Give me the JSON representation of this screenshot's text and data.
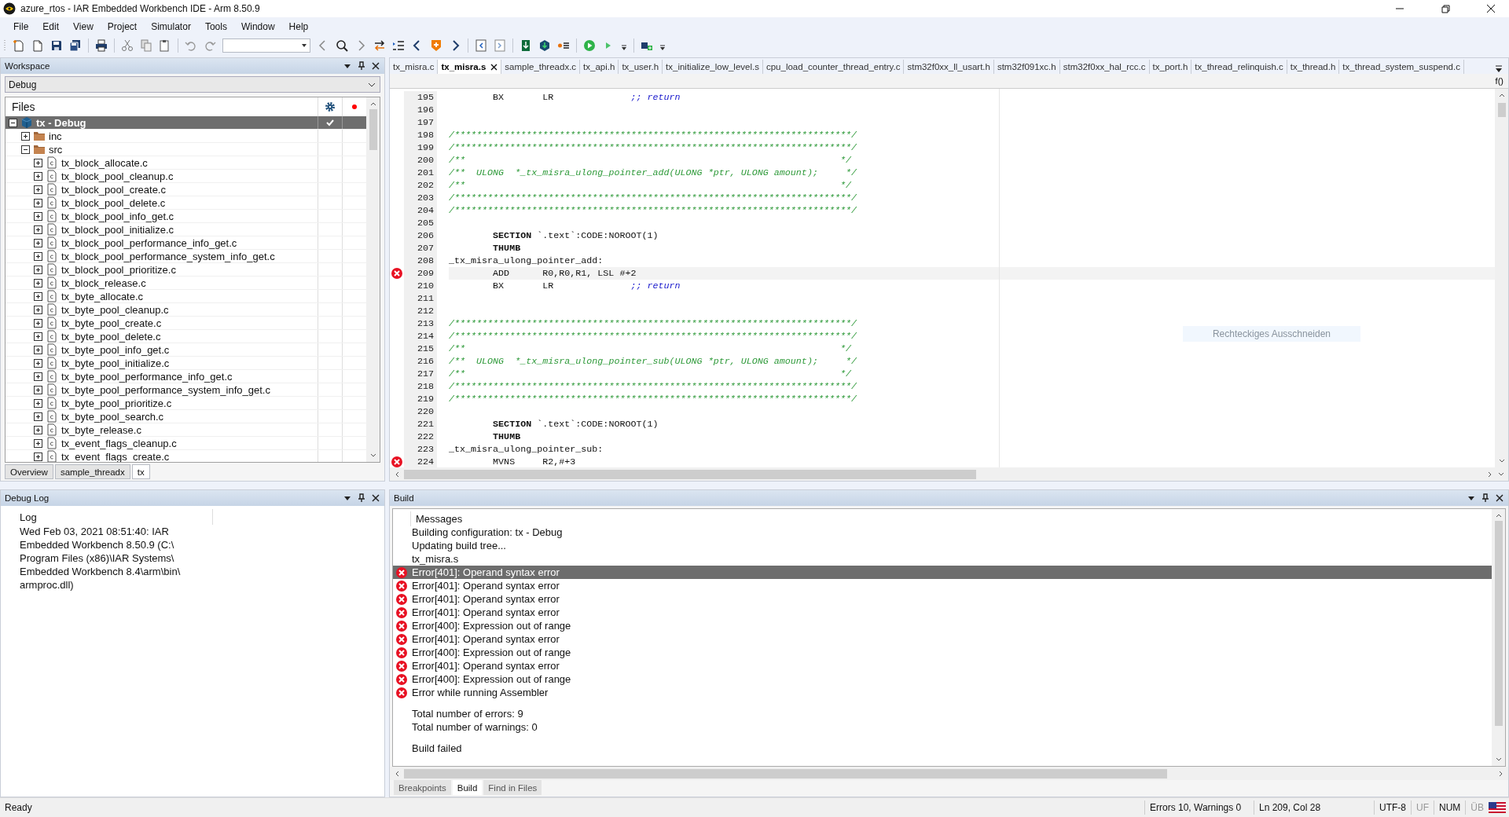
{
  "window": {
    "title": "azure_rtos - IAR Embedded Workbench IDE - Arm 8.50.9"
  },
  "menu": [
    "File",
    "Edit",
    "View",
    "Project",
    "Simulator",
    "Tools",
    "Window",
    "Help"
  ],
  "workspace": {
    "title": "Workspace",
    "configuration": "Debug",
    "files_header": "Files",
    "tree": {
      "label": "tx - Debug",
      "kind": "project",
      "expanded": true,
      "selected": true,
      "checked": true,
      "children": [
        {
          "label": "inc",
          "kind": "folder",
          "expanded": false,
          "selected": false
        },
        {
          "label": "src",
          "kind": "folder",
          "expanded": true,
          "selected": false,
          "children": [
            {
              "label": "tx_block_allocate.c",
              "kind": "file",
              "expanded": false,
              "selected": false
            },
            {
              "label": "tx_block_pool_cleanup.c",
              "kind": "file",
              "expanded": false,
              "selected": false
            },
            {
              "label": "tx_block_pool_create.c",
              "kind": "file",
              "expanded": false,
              "selected": false
            },
            {
              "label": "tx_block_pool_delete.c",
              "kind": "file",
              "expanded": false,
              "selected": false
            },
            {
              "label": "tx_block_pool_info_get.c",
              "kind": "file",
              "expanded": false,
              "selected": false
            },
            {
              "label": "tx_block_pool_initialize.c",
              "kind": "file",
              "expanded": false,
              "selected": false
            },
            {
              "label": "tx_block_pool_performance_info_get.c",
              "kind": "file",
              "expanded": false,
              "selected": false
            },
            {
              "label": "tx_block_pool_performance_system_info_get.c",
              "kind": "file",
              "expanded": false,
              "selected": false
            },
            {
              "label": "tx_block_pool_prioritize.c",
              "kind": "file",
              "expanded": false,
              "selected": false
            },
            {
              "label": "tx_block_release.c",
              "kind": "file",
              "expanded": false,
              "selected": false
            },
            {
              "label": "tx_byte_allocate.c",
              "kind": "file",
              "expanded": false,
              "selected": false
            },
            {
              "label": "tx_byte_pool_cleanup.c",
              "kind": "file",
              "expanded": false,
              "selected": false
            },
            {
              "label": "tx_byte_pool_create.c",
              "kind": "file",
              "expanded": false,
              "selected": false
            },
            {
              "label": "tx_byte_pool_delete.c",
              "kind": "file",
              "expanded": false,
              "selected": false
            },
            {
              "label": "tx_byte_pool_info_get.c",
              "kind": "file",
              "expanded": false,
              "selected": false
            },
            {
              "label": "tx_byte_pool_initialize.c",
              "kind": "file",
              "expanded": false,
              "selected": false
            },
            {
              "label": "tx_byte_pool_performance_info_get.c",
              "kind": "file",
              "expanded": false,
              "selected": false
            },
            {
              "label": "tx_byte_pool_performance_system_info_get.c",
              "kind": "file",
              "expanded": false,
              "selected": false
            },
            {
              "label": "tx_byte_pool_prioritize.c",
              "kind": "file",
              "expanded": false,
              "selected": false
            },
            {
              "label": "tx_byte_pool_search.c",
              "kind": "file",
              "expanded": false,
              "selected": false
            },
            {
              "label": "tx_byte_release.c",
              "kind": "file",
              "expanded": false,
              "selected": false
            },
            {
              "label": "tx_event_flags_cleanup.c",
              "kind": "file",
              "expanded": false,
              "selected": false
            },
            {
              "label": "tx_event_flags_create.c",
              "kind": "file",
              "expanded": false,
              "selected": false
            }
          ]
        }
      ]
    },
    "tabs": [
      {
        "label": "Overview",
        "selected": false
      },
      {
        "label": "sample_threadx",
        "selected": false
      },
      {
        "label": "tx",
        "selected": true
      }
    ]
  },
  "editor": {
    "tabs": [
      {
        "label": "tx_misra.c",
        "selected": false
      },
      {
        "label": "tx_misra.s",
        "selected": true
      },
      {
        "label": "sample_threadx.c",
        "selected": false
      },
      {
        "label": "tx_api.h",
        "selected": false
      },
      {
        "label": "tx_user.h",
        "selected": false
      },
      {
        "label": "tx_initialize_low_level.s",
        "selected": false
      },
      {
        "label": "cpu_load_counter_thread_entry.c",
        "selected": false
      },
      {
        "label": "stm32f0xx_ll_usart.h",
        "selected": false
      },
      {
        "label": "stm32f091xc.h",
        "selected": false
      },
      {
        "label": "stm32f0xx_hal_rcc.c",
        "selected": false
      },
      {
        "label": "tx_port.h",
        "selected": false
      },
      {
        "label": "tx_thread_relinquish.c",
        "selected": false
      },
      {
        "label": "tx_thread.h",
        "selected": false
      },
      {
        "label": "tx_thread_system_suspend.c",
        "selected": false
      }
    ],
    "function_button": "f()",
    "tooltip": "Rechteckiges Ausschneiden",
    "lines": [
      {
        "number": "195",
        "kind": "instruction",
        "error": false,
        "current": false,
        "op": "BX",
        "args": "LR",
        "remark": ";; return"
      },
      {
        "number": "196",
        "kind": "blank",
        "error": false,
        "current": false
      },
      {
        "number": "197",
        "kind": "blank",
        "error": false,
        "current": false
      },
      {
        "number": "198",
        "kind": "comment",
        "error": false,
        "current": false,
        "text": "/************************************************************************/"
      },
      {
        "number": "199",
        "kind": "comment",
        "error": false,
        "current": false,
        "text": "/************************************************************************/"
      },
      {
        "number": "200",
        "kind": "comment",
        "error": false,
        "current": false,
        "text": "/**                                                                    */"
      },
      {
        "number": "201",
        "kind": "comment",
        "error": false,
        "current": false,
        "text": "/**  ULONG  *_tx_misra_ulong_pointer_add(ULONG *ptr, ULONG amount);     */"
      },
      {
        "number": "202",
        "kind": "comment",
        "error": false,
        "current": false,
        "text": "/**                                                                    */"
      },
      {
        "number": "203",
        "kind": "comment",
        "error": false,
        "current": false,
        "text": "/************************************************************************/"
      },
      {
        "number": "204",
        "kind": "comment",
        "error": false,
        "current": false,
        "text": "/************************************************************************/"
      },
      {
        "number": "205",
        "kind": "blank",
        "error": false,
        "current": false
      },
      {
        "number": "206",
        "kind": "directive",
        "error": false,
        "current": false,
        "op": "SECTION",
        "args": "`.text`:CODE:NOROOT(1)"
      },
      {
        "number": "207",
        "kind": "directive",
        "error": false,
        "current": false,
        "op": "THUMB"
      },
      {
        "number": "208",
        "kind": "label",
        "error": false,
        "current": false,
        "text": "_tx_misra_ulong_pointer_add:"
      },
      {
        "number": "209",
        "kind": "instruction",
        "error": true,
        "current": true,
        "op": "ADD",
        "args": "R0,R0,R1, LSL #+2"
      },
      {
        "number": "210",
        "kind": "instruction",
        "error": false,
        "current": false,
        "op": "BX",
        "args": "LR",
        "remark": ";; return"
      },
      {
        "number": "211",
        "kind": "blank",
        "error": false,
        "current": false
      },
      {
        "number": "212",
        "kind": "blank",
        "error": false,
        "current": false
      },
      {
        "number": "213",
        "kind": "comment",
        "error": false,
        "current": false,
        "text": "/************************************************************************/"
      },
      {
        "number": "214",
        "kind": "comment",
        "error": false,
        "current": false,
        "text": "/************************************************************************/"
      },
      {
        "number": "215",
        "kind": "comment",
        "error": false,
        "current": false,
        "text": "/**                                                                    */"
      },
      {
        "number": "216",
        "kind": "comment",
        "error": false,
        "current": false,
        "text": "/**  ULONG  *_tx_misra_ulong_pointer_sub(ULONG *ptr, ULONG amount);     */"
      },
      {
        "number": "217",
        "kind": "comment",
        "error": false,
        "current": false,
        "text": "/**                                                                    */"
      },
      {
        "number": "218",
        "kind": "comment",
        "error": false,
        "current": false,
        "text": "/************************************************************************/"
      },
      {
        "number": "219",
        "kind": "comment",
        "error": false,
        "current": false,
        "text": "/************************************************************************/"
      },
      {
        "number": "220",
        "kind": "blank",
        "error": false,
        "current": false
      },
      {
        "number": "221",
        "kind": "directive",
        "error": false,
        "current": false,
        "op": "SECTION",
        "args": "`.text`:CODE:NOROOT(1)"
      },
      {
        "number": "222",
        "kind": "directive",
        "error": false,
        "current": false,
        "op": "THUMB"
      },
      {
        "number": "223",
        "kind": "label",
        "error": false,
        "current": false,
        "text": "_tx_misra_ulong_pointer_sub:"
      },
      {
        "number": "224",
        "kind": "instruction",
        "error": true,
        "current": false,
        "op": "MVNS",
        "args": "R2,#+3"
      }
    ]
  },
  "debug_log": {
    "title": "Debug Log",
    "column": "Log",
    "entries": [
      "Wed Feb 03, 2021 08:51:40: IAR Embedded Workbench 8.50.9 (C:\\Program Files (x86)\\IAR Systems\\Embedded Workbench 8.4\\arm\\bin\\armproc.dll)"
    ]
  },
  "build": {
    "title": "Build",
    "column": "Messages",
    "messages": [
      {
        "kind": "info",
        "text": "Building configuration: tx - Debug",
        "selected": false
      },
      {
        "kind": "info",
        "text": "Updating build tree...",
        "selected": false
      },
      {
        "kind": "info",
        "text": "tx_misra.s",
        "selected": false
      },
      {
        "kind": "error",
        "text": "Error[401]: Operand syntax error",
        "selected": true
      },
      {
        "kind": "error",
        "text": "Error[401]: Operand syntax error",
        "selected": false
      },
      {
        "kind": "error",
        "text": "Error[401]: Operand syntax error",
        "selected": false
      },
      {
        "kind": "error",
        "text": "Error[401]: Operand syntax error",
        "selected": false
      },
      {
        "kind": "error",
        "text": "Error[400]: Expression out of range",
        "selected": false
      },
      {
        "kind": "error",
        "text": "Error[401]: Operand syntax error",
        "selected": false
      },
      {
        "kind": "error",
        "text": "Error[400]: Expression out of range",
        "selected": false
      },
      {
        "kind": "error",
        "text": "Error[401]: Operand syntax error",
        "selected": false
      },
      {
        "kind": "error",
        "text": "Error[400]: Expression out of range",
        "selected": false
      },
      {
        "kind": "error",
        "text": "Error while running Assembler",
        "selected": false
      }
    ],
    "totals": [
      "Total number of errors: 9",
      "Total number of warnings: 0"
    ],
    "result": "Build failed",
    "tabs": [
      {
        "label": "Breakpoints",
        "selected": false
      },
      {
        "label": "Build",
        "selected": true
      },
      {
        "label": "Find in Files",
        "selected": false
      }
    ]
  },
  "status_bar": {
    "text": "Ready",
    "errors": "Errors 10, Warnings 0",
    "position": "Ln 209, Col 28",
    "encoding": "UTF-8",
    "indicators": [
      {
        "label": "UF",
        "on": false
      },
      {
        "label": "NUM",
        "on": true
      },
      {
        "label": "ÜB",
        "on": false
      }
    ]
  }
}
